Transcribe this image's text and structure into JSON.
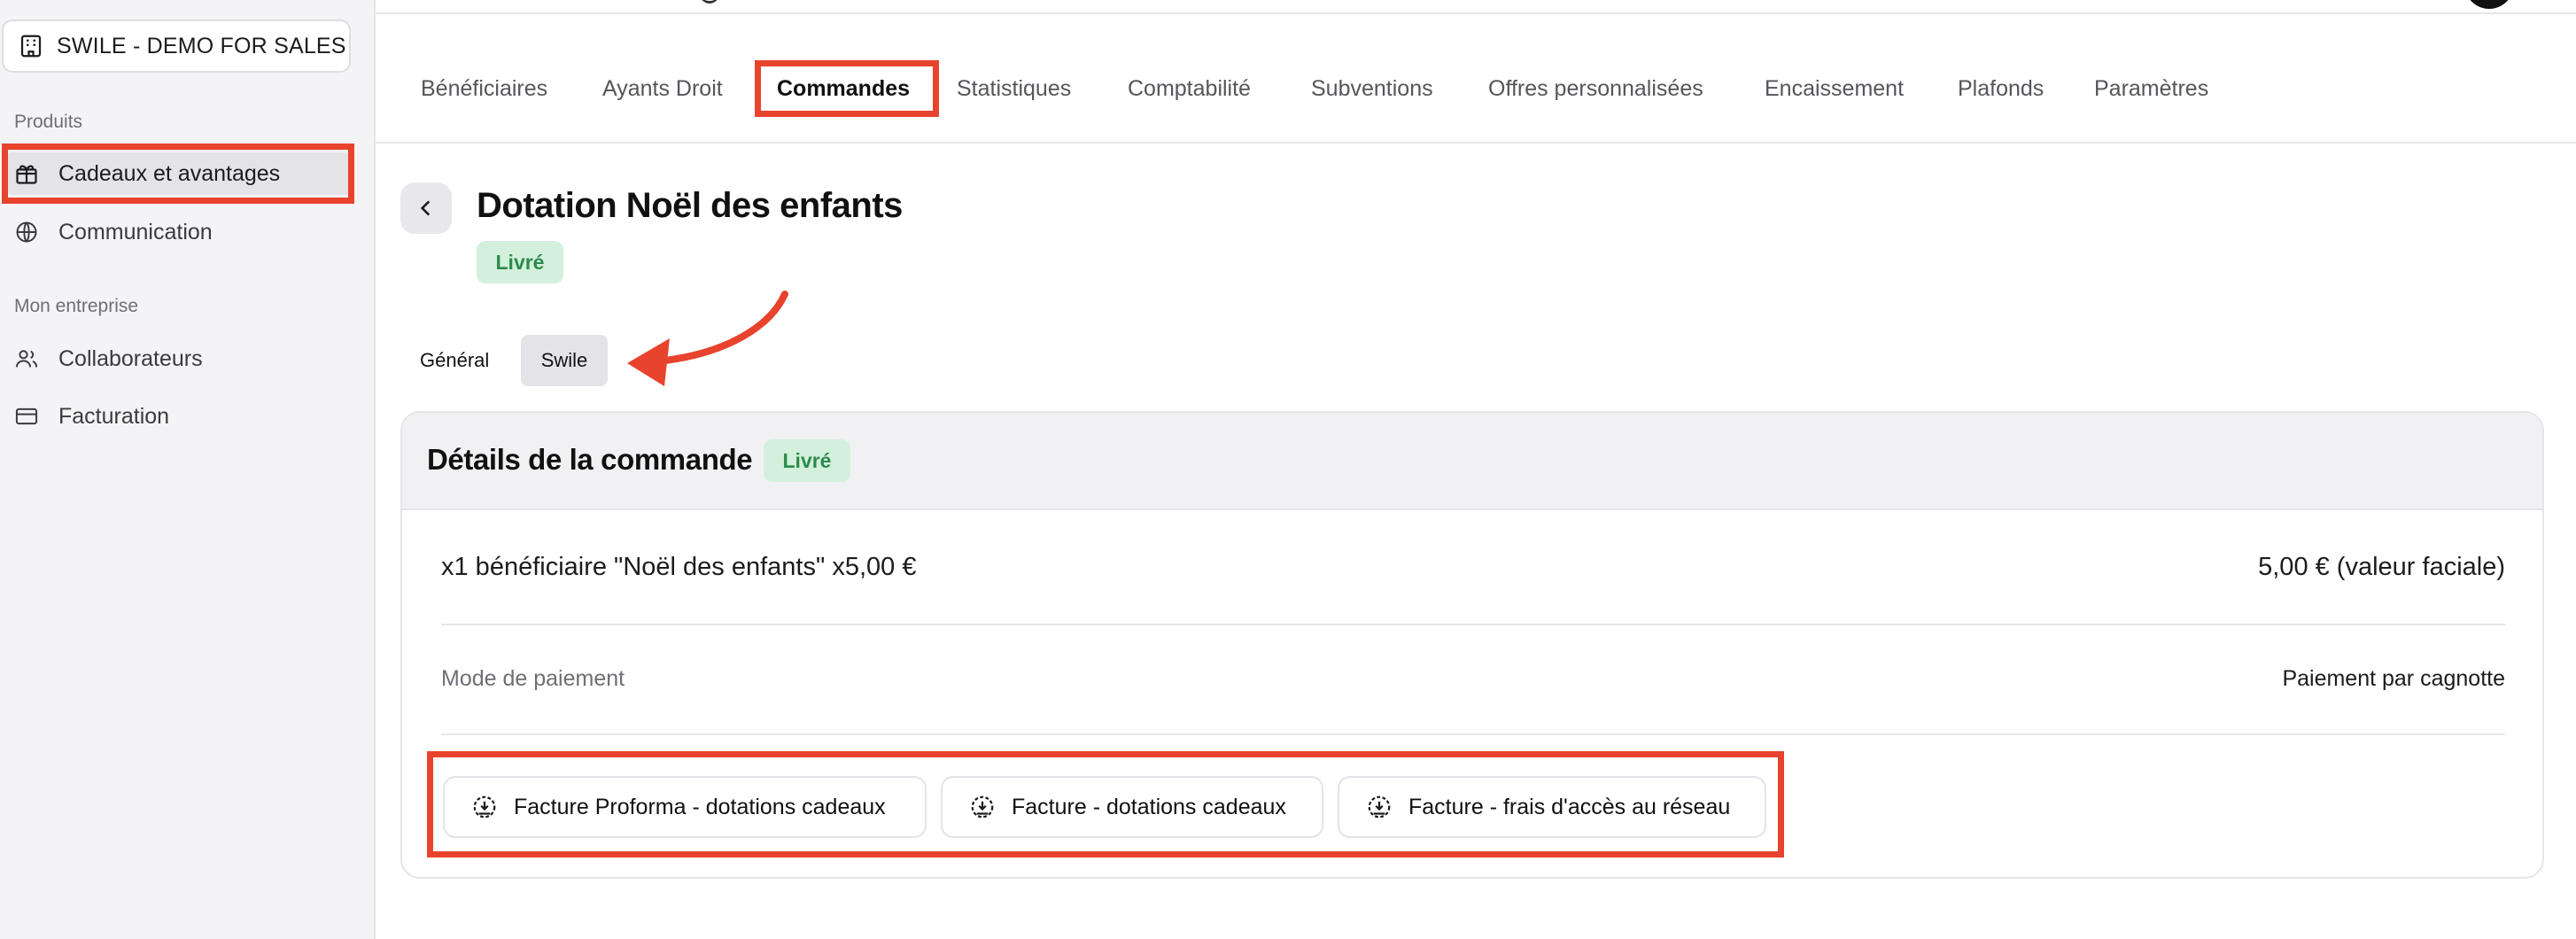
{
  "sidebar": {
    "company": "SWILE - DEMO FOR SALES",
    "sections": [
      {
        "title": "Produits",
        "items": [
          {
            "label": "Cadeaux et avantages",
            "icon": "gift-icon",
            "active": true
          },
          {
            "label": "Communication",
            "icon": "globe-icon",
            "active": false
          }
        ]
      },
      {
        "title": "Mon entreprise",
        "items": [
          {
            "label": "Collaborateurs",
            "icon": "users-icon",
            "active": false
          },
          {
            "label": "Facturation",
            "icon": "credit-card-icon",
            "active": false
          }
        ]
      }
    ]
  },
  "tabs": [
    "Bénéficiaires",
    "Ayants Droit",
    "Commandes",
    "Statistiques",
    "Comptabilité",
    "Subventions",
    "Offres personnalisées",
    "Encaissement",
    "Plafonds",
    "Paramètres"
  ],
  "active_tab": "Commandes",
  "header": {
    "title": "Dotation Noël des enfants",
    "status": "Livré"
  },
  "subtabs": [
    "Général",
    "Swile"
  ],
  "active_subtab": "Swile",
  "order": {
    "title": "Détails de la commande",
    "status": "Livré",
    "line_item": "x1 bénéficiaire \"Noël des enfants\" x5,00 €",
    "line_value": "5,00 € (valeur faciale)",
    "payment_label": "Mode de paiement",
    "payment_value": "Paiement par cagnotte",
    "downloads": [
      "Facture Proforma - dotations cadeaux",
      "Facture - dotations cadeaux",
      "Facture - frais d'accès au réseau"
    ]
  },
  "colors": {
    "highlight": "#e8432d",
    "badge_bg": "#d3f0dc",
    "badge_text": "#2d8a4c",
    "sidebar_bg": "#f4f4f6"
  }
}
